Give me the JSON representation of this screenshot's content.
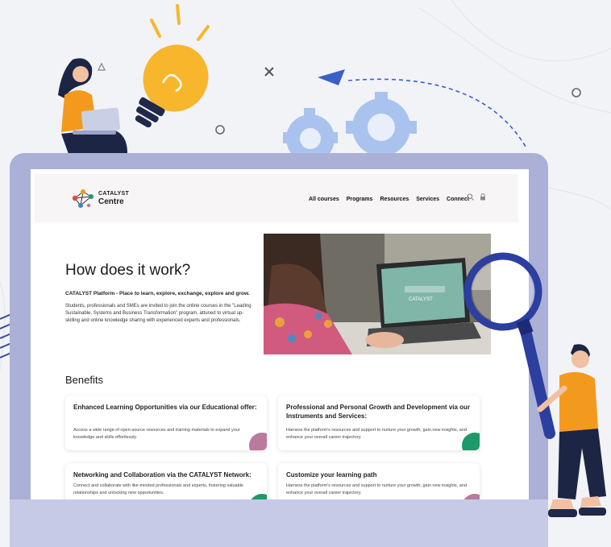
{
  "site": {
    "logo": {
      "line1": "CATALYST",
      "line2": "Centre"
    },
    "nav": [
      "All courses",
      "Programs",
      "Resources",
      "Services",
      "Connect"
    ]
  },
  "hero": {
    "title": "How does it work?",
    "tagline": "CATALYST Platform - Place to learn, explore, exchange, explore and grow.",
    "body": "Students, professionals and SMEs are invited to join the online courses in the \"Leading Sustainable, Systems and Business Transformation\" program, attuned to virtual up-skilling and online knowledge sharing with experienced experts and professionals.",
    "laptop_screen_text": "CATALYST"
  },
  "benefits": {
    "title": "Benefits",
    "cards": [
      {
        "title": "Enhanced Learning Opportunities via our Educational offer:",
        "text": "Access a wide range of open-source resources and training materials to expand your knowledge and skills effortlessly."
      },
      {
        "title": "Professional and Personal Growth and Development via our Instruments and Services:",
        "text": "Harness the platform's resources and support to nurture your growth, gain new insights, and enhance your overall career trajectory."
      },
      {
        "title": "Networking and Collaboration via the CATALYST Network:",
        "text": "Connect and collaborate with like-minded professionals and experts, fostering valuable relationships and unlocking new opportunities."
      },
      {
        "title": "Customize your learning path",
        "text": "Harness the platform's resources and support to nurture your growth, gain new insights, and enhance your overall career trajectory."
      }
    ]
  },
  "colors": {
    "monitor": "#aab0d6",
    "accent_pink": "#b97a9e",
    "accent_green": "#1e9a6a",
    "bulb": "#f8b62d",
    "orange_shirt": "#f39a1e",
    "navy": "#20294a"
  }
}
